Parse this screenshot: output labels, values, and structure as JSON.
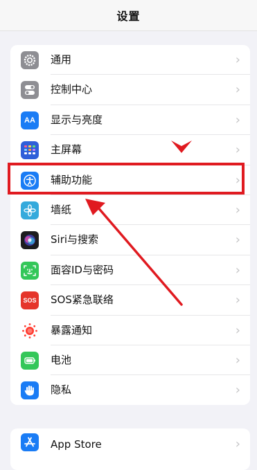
{
  "header": {
    "title": "设置"
  },
  "groups": [
    {
      "items": [
        {
          "label": "通用",
          "icon": "gear-icon",
          "color": "#8e8e93"
        },
        {
          "label": "控制中心",
          "icon": "toggles-icon",
          "color": "#8e8e93"
        },
        {
          "label": "显示与亮度",
          "icon": "aa-icon",
          "icon_text": "AA",
          "color": "#1a7cf5"
        },
        {
          "label": "主屏幕",
          "icon": "home-grid-icon",
          "color": "#2f5fd9"
        },
        {
          "label": "辅助功能",
          "icon": "accessibility-icon",
          "color": "#1a7cf5"
        },
        {
          "label": "墙纸",
          "icon": "flower-icon",
          "color": "#35aadc"
        },
        {
          "label": "Siri与搜索",
          "icon": "siri-icon",
          "color": "#1c1c1e"
        },
        {
          "label": "面容ID与密码",
          "icon": "faceid-icon",
          "color": "#34c759"
        },
        {
          "label": "SOS紧急联络",
          "icon": "sos-icon",
          "icon_text": "SOS",
          "color": "#e5352b"
        },
        {
          "label": "暴露通知",
          "icon": "exposure-icon",
          "color": "#ffffff"
        },
        {
          "label": "电池",
          "icon": "battery-icon",
          "color": "#34c759"
        },
        {
          "label": "隐私",
          "icon": "hand-icon",
          "color": "#1a7cf5"
        }
      ]
    },
    {
      "items": [
        {
          "label": "App Store",
          "icon": "app-store-icon",
          "color": "#1a7cf5"
        }
      ]
    }
  ],
  "chevron": "›",
  "annotation": {
    "color": "#e01a20",
    "highlighted_item": "辅助功能"
  }
}
